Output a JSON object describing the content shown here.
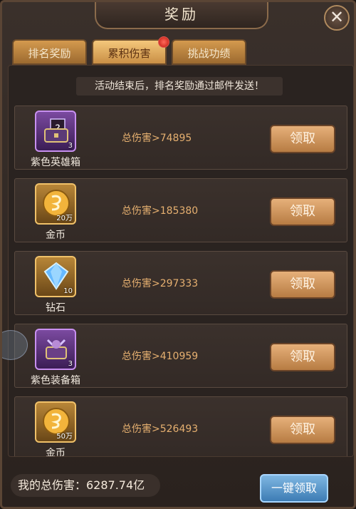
{
  "window": {
    "title": "奖励"
  },
  "tabs": [
    {
      "label": "排名奖励",
      "active": false
    },
    {
      "label": "累积伤害",
      "active": true,
      "has_notification": true
    },
    {
      "label": "挑战功绩",
      "active": false
    }
  ],
  "notice": "活动结束后，排名奖励通过邮件发送！",
  "rewards": [
    {
      "name": "紫色英雄箱",
      "qty": "3",
      "rarity": "purple",
      "icon": "hero-chest-icon",
      "damage": "总伤害>74895",
      "button": "领取"
    },
    {
      "name": "金币",
      "qty": "20万",
      "rarity": "gold",
      "icon": "gold-coin-icon",
      "damage": "总伤害>185380",
      "button": "领取"
    },
    {
      "name": "钻石",
      "qty": "10",
      "rarity": "gold",
      "icon": "diamond-icon",
      "damage": "总伤害>297333",
      "button": "领取"
    },
    {
      "name": "紫色装备箱",
      "qty": "3",
      "rarity": "purple",
      "icon": "equipment-chest-icon",
      "damage": "总伤害>410959",
      "button": "领取"
    },
    {
      "name": "金币",
      "qty": "50万",
      "rarity": "gold",
      "icon": "gold-coin-icon",
      "damage": "总伤害>526493",
      "button": "领取"
    }
  ],
  "footer": {
    "total_damage": "我的总伤害：6287.74亿",
    "claim_all": "一键领取"
  },
  "colors": {
    "accent": "#e6b070",
    "tab_active": "#f4c77b",
    "purple_frame": "#c890f0",
    "gold_frame": "#f0c169"
  }
}
